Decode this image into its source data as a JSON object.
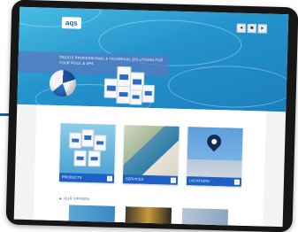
{
  "site": {
    "logo_text": "aqs",
    "top_buttons": [
      "◂",
      "■",
      "▸"
    ]
  },
  "hero": {
    "banner_text": "TREATS PROFESSIONAL & TECHNICAL SOLUTIONS FOR YOUR POOL & SPA"
  },
  "cards": [
    {
      "label": "PRODUCTS"
    },
    {
      "label": "SERVICES"
    },
    {
      "label": "LOCATIONS"
    }
  ],
  "section": {
    "title": "▲ OUR OFFERS"
  },
  "colors": {
    "accent": "#1f60c6",
    "water": "#2493cc",
    "pin": "#142c55"
  }
}
